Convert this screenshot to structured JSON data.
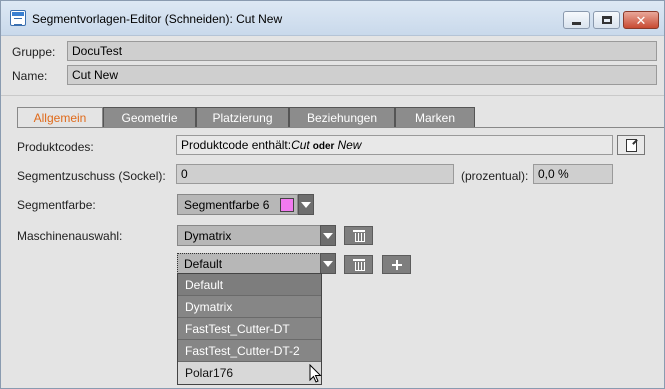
{
  "window": {
    "title": "Segmentvorlagen-Editor (Schneiden): Cut New",
    "icons": {
      "app": "editor-app-icon",
      "minimize": "minimize-icon",
      "maximize": "maximize-icon",
      "close": "close-icon"
    }
  },
  "header": {
    "group_label": "Gruppe:",
    "group_value": "DocuTest",
    "name_label": "Name:",
    "name_value": "Cut New"
  },
  "tabs": [
    {
      "label": "Allgemein",
      "active": true
    },
    {
      "label": "Geometrie",
      "active": false
    },
    {
      "label": "Platzierung",
      "active": false
    },
    {
      "label": "Beziehungen",
      "active": false
    },
    {
      "label": "Marken",
      "active": false
    }
  ],
  "form": {
    "product_codes_label": "Produktcodes:",
    "product_codes_prefix": "Produktcode enthält:",
    "product_codes_term1": "Cut",
    "product_codes_operator": "oder",
    "product_codes_term2": "New",
    "segment_surcharge_label": "Segmentzuschuss (Sockel):",
    "segment_surcharge_value": "0",
    "percent_label": "(prozentual):",
    "percent_value": "0,0 %",
    "segment_color_label": "Segmentfarbe:",
    "segment_color_value": "Segmentfarbe 6",
    "segment_color_hex": "#f27af0",
    "machine_label": "Maschinenauswahl:",
    "machine_value": "Dymatrix",
    "profile_value": "Default"
  },
  "dropdown": {
    "options": [
      "Default",
      "Dymatrix",
      "FastTest_Cutter-DT",
      "FastTest_Cutter-DT-2",
      "Polar176"
    ],
    "hovered": "Polar176"
  },
  "colors": {
    "active_tab": "#e06a1a",
    "inactive_tab_bg": "#8c8c8c"
  }
}
